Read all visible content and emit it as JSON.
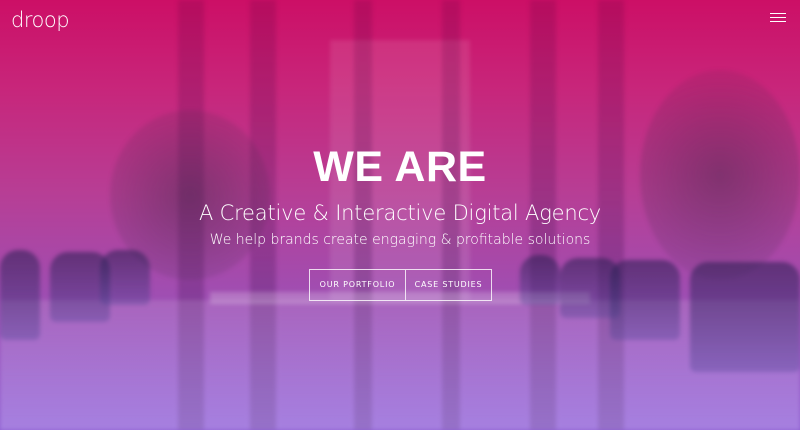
{
  "brand": {
    "logo_text": "droop"
  },
  "nav": {
    "menu_icon": "hamburger-menu-icon"
  },
  "hero": {
    "headline": "WE ARE",
    "subheadline": "A Creative & Interactive Digital Agency",
    "tagline": "We help brands create engaging & profitable solutions"
  },
  "cta": {
    "portfolio_label": "OUR PORTFOLIO",
    "case_studies_label": "CASE STUDIES"
  },
  "colors": {
    "gradient_top": "#cc0f66",
    "gradient_bottom": "#8f5fd0",
    "text": "#ffffff"
  }
}
